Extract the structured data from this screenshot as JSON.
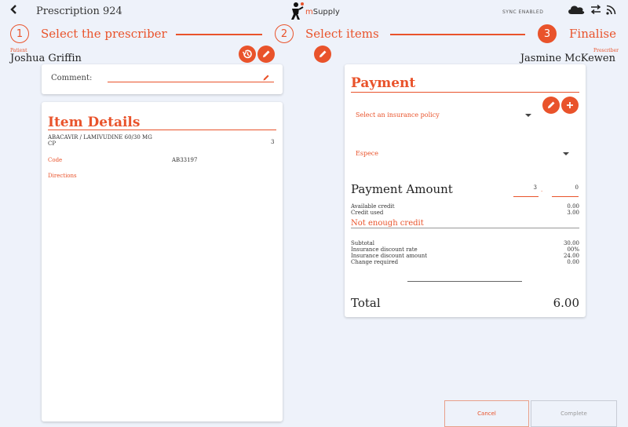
{
  "header": {
    "title": "Prescription 924",
    "logo_text_m": "m",
    "logo_text": "Supply",
    "sync_status": "SYNC ENABLED"
  },
  "steps": [
    {
      "number": "1",
      "label": "Select the prescriber"
    },
    {
      "number": "2",
      "label": "Select items"
    },
    {
      "number": "3",
      "label": "Finalise"
    }
  ],
  "patient": {
    "label": "Patient",
    "name": "Joshua Griffin"
  },
  "prescriber": {
    "label": "Prescriber",
    "name": "Jasmine McKewen"
  },
  "comment": {
    "label": "Comment:",
    "value": ""
  },
  "item_details": {
    "heading": "Item Details",
    "item_name": "ABACAVIR / LAMIVUDINE 60/30 MG CP",
    "quantity": "3",
    "code_label": "Code",
    "code_value": "AB33197",
    "directions_label": "Directions"
  },
  "payment": {
    "heading": "Payment",
    "insurance_placeholder": "Select an insurance policy",
    "payment_type": "Espece",
    "amount_label": "Payment Amount",
    "amount_whole": "3",
    "amount_cents": "0",
    "available_credit_label": "Available credit",
    "available_credit_value": "0.00",
    "credit_used_label": "Credit used",
    "credit_used_value": "3.00",
    "warning": "Not enough credit",
    "subtotal_label": "Subtotal",
    "subtotal_value": "30.00",
    "discount_rate_label": "Insurance discount rate",
    "discount_rate_value": "00%",
    "discount_amount_label": "Insurance discount amount",
    "discount_amount_value": "24.00",
    "change_label": "Change required",
    "change_value": "0.00",
    "total_label": "Total",
    "total_value": "6.00"
  },
  "actions": {
    "cancel": "Cancel",
    "complete": "Complete"
  },
  "colors": {
    "accent": "#e9532b",
    "background": "#eef2fa"
  }
}
